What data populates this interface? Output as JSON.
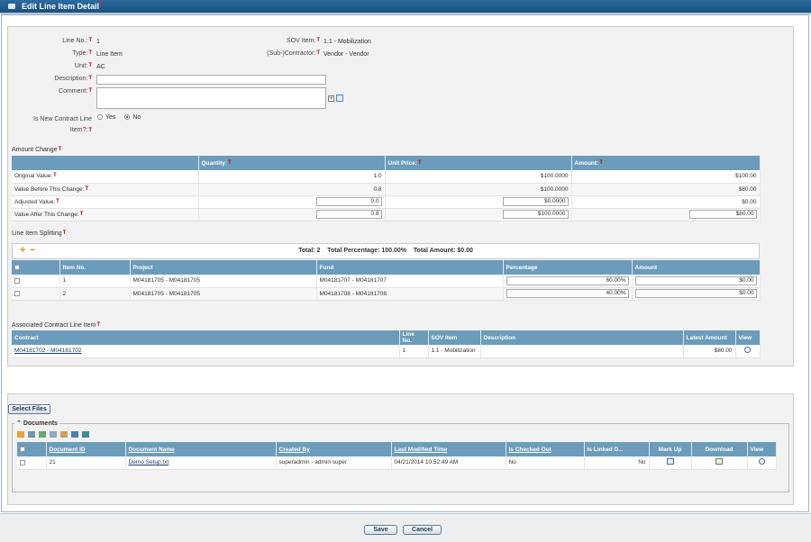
{
  "window": {
    "title": "Edit Line Item Detail"
  },
  "detail": {
    "line_no_label": "Line No.:",
    "line_no": "1",
    "sov_item_label": "SOV Item:",
    "sov_item": "1.1 - Mobilization",
    "type_label": "Type:",
    "type": "Line Item",
    "subcontractor_label": "(Sub-)Contractor:",
    "subcontractor": "Vendor - Vendor",
    "unit_label": "Unit:",
    "unit": "AC",
    "description_label": "Description:",
    "description_value": "",
    "comment_label": "Comment:",
    "comment_value": "",
    "is_new_label_1": "Is New Contract Line",
    "is_new_label_2": "Item?:",
    "yes_label": "Yes",
    "no_label": "No",
    "selected": "No"
  },
  "amount_change": {
    "title": "Amount Change",
    "headers": [
      "",
      "Quantity:",
      "Unit Price:",
      "Amount:"
    ],
    "rows": [
      {
        "label": "Original Value:",
        "quantity": "1.0",
        "unit_price": "$100.0000",
        "amount": "$100.00"
      },
      {
        "label": "Value Before This Change:",
        "quantity": "0.8",
        "unit_price": "$100.0000",
        "amount": "$80.00"
      },
      {
        "label": "Adjusted Value:",
        "quantity": "0.0",
        "unit_price": "$0.0000",
        "amount": "$0.00"
      },
      {
        "label": "Value After This Change:",
        "quantity": "0.8",
        "unit_price": "$100.0000",
        "amount": "$80.00"
      }
    ]
  },
  "splitting": {
    "title": "Line Item Splitting",
    "summary": "Total: 2    Total Percentage: 100.00%    Total Amount: $0.00",
    "headers": [
      "",
      "Item No.",
      "Project",
      "Fund",
      "Percentage",
      "Amount"
    ],
    "rows": [
      {
        "item_no": "1",
        "project": "M04181705 - M04181705",
        "fund": "M04181707 - M04181707",
        "percentage": "60.00%",
        "amount": "$0.00"
      },
      {
        "item_no": "2",
        "project": "M04181705 - M04181705",
        "fund": "M04181708 - M04181708",
        "percentage": "40.00%",
        "amount": "$0.00"
      }
    ]
  },
  "associated": {
    "title": "Associated Contract Line Item",
    "headers": [
      "Contract",
      "Line No.",
      "SOV Item",
      "Description",
      "Latest Amount",
      "View"
    ],
    "rows": [
      {
        "contract": "M04181702 - M04181702",
        "line_no": "1",
        "sov_item": "1.1 - Mobilization",
        "description": "",
        "latest_amount": "$80.00"
      }
    ]
  },
  "files": {
    "select_files_label": "Select Files",
    "documents_label": "Documents",
    "headers": [
      "",
      "Document ID",
      "Document Name",
      "Created By",
      "Last Modified Time",
      "Is Checked Out",
      "Is Linked D...",
      "Mark Up",
      "Download",
      "View"
    ],
    "rows": [
      {
        "document_id": "21",
        "document_name": "Demo Setup.txt",
        "created_by": "superadmin - admin super",
        "last_modified": "04/21/2014 10:52:49 AM",
        "is_checked_out": "No",
        "is_linked": "No"
      }
    ]
  },
  "footer": {
    "save_label": "Save",
    "cancel_label": "Cancel"
  },
  "colors": {
    "title_bar": "#1a4f7e",
    "grid_header": "#6b9cbc",
    "required_mark": "#cc0000"
  },
  "icons": [
    "window-icon",
    "add-icon",
    "remove-icon",
    "view-icon",
    "markup-icon",
    "download-icon",
    "spellcheck-icon",
    "expand-icon",
    "collapse-icon"
  ]
}
